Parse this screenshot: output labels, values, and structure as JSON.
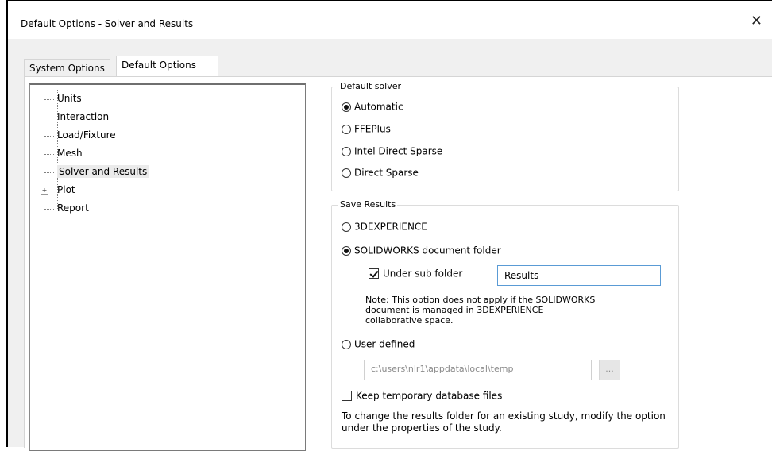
{
  "window": {
    "title": "Default Options - Solver and Results",
    "close_icon": "close-icon"
  },
  "tabs": [
    {
      "label": "System Options",
      "active": false
    },
    {
      "label": "Default Options",
      "active": true
    }
  ],
  "tree": {
    "items": [
      {
        "label": "Units"
      },
      {
        "label": "Interaction"
      },
      {
        "label": "Load/Fixture"
      },
      {
        "label": "Mesh"
      },
      {
        "label": "Solver and Results",
        "selected": true
      },
      {
        "label": "Plot",
        "expandable": true
      },
      {
        "label": "Report"
      }
    ]
  },
  "default_solver": {
    "title": "Default solver",
    "options": [
      {
        "label": "Automatic",
        "selected": true
      },
      {
        "label": "FFEPlus",
        "selected": false
      },
      {
        "label": "Intel Direct Sparse",
        "selected": false
      },
      {
        "label": "Direct Sparse",
        "selected": false
      }
    ]
  },
  "save_results": {
    "title": "Save Results",
    "option_3dexperience": "3DEXPERIENCE",
    "option_doc_folder": "SOLIDWORKS document folder",
    "under_sub_folder_label": "Under sub folder",
    "under_sub_folder_checked": true,
    "sub_folder_value": "Results",
    "note": "Note: This option does not apply if the SOLIDWORKS document is managed in 3DEXPERIENCE collaborative space.",
    "option_user_defined": "User defined",
    "user_path": "c:\\users\\nlr1\\appdata\\local\\temp",
    "browse_label": "...",
    "keep_temp_label": "Keep temporary database files",
    "keep_temp_checked": false,
    "help_text": "To change the results folder for an existing study, modify the option under the properties of the study."
  }
}
